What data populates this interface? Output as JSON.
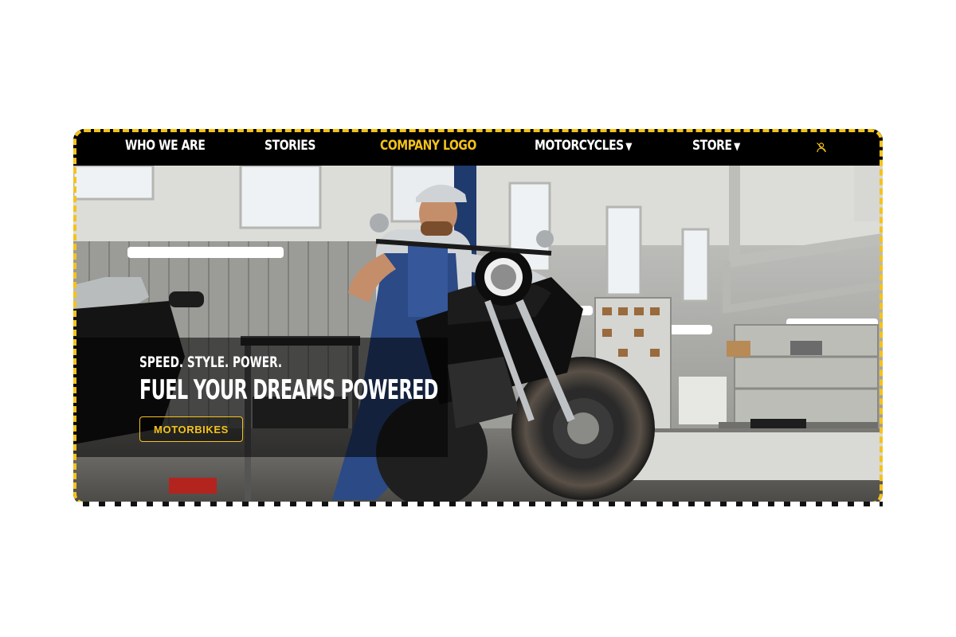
{
  "nav": {
    "who_we_are": "WHO WE ARE",
    "stories": "STORIES",
    "logo": "COMPANY LOGO",
    "motorcycles": "MOTORCYCLES",
    "store": "STORE",
    "caret": "▼",
    "user_icon": "user-slash-icon"
  },
  "hero": {
    "kicker": "SPEED. STYLE. POWER.",
    "headline": "FUEL YOUR DREAMS POWERED",
    "cta_label": "MOTORBIKES",
    "image": "mechanic-on-motorcycle-in-garage-photo"
  },
  "colors": {
    "accent": "#f4c21b",
    "nav_bg": "#000000",
    "text": "#ffffff"
  }
}
